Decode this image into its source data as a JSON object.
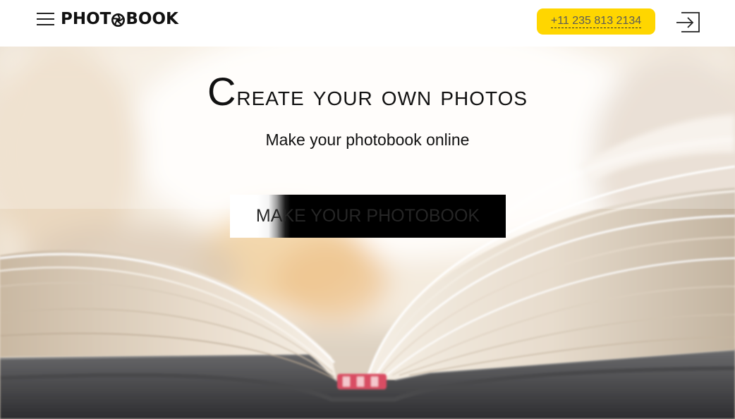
{
  "header": {
    "logo_prefix": "PHOT",
    "logo_suffix": "BOOK",
    "phone": "+11 235 813 2134"
  },
  "hero": {
    "title": "Create your own photos",
    "subtitle": "Make your photobook online",
    "cta_label": "MAKE YOUR PHOTOBOOK"
  },
  "icons": {
    "menu": "hamburger-menu-icon",
    "logo_o": "camera-aperture-icon",
    "login": "sign-in-arrow-icon"
  },
  "colors": {
    "accent": "#ffd600",
    "text": "#111111",
    "cta_background": "#000000"
  }
}
